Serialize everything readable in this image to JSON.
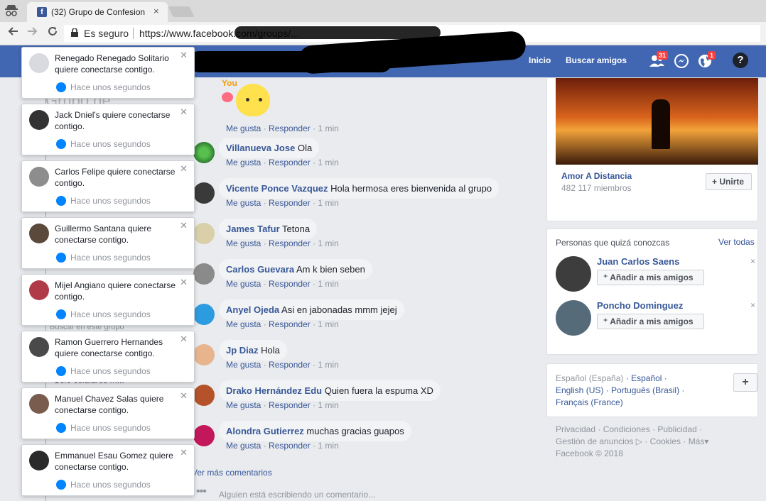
{
  "browser": {
    "tab_title": "(32) Grupo de Confesion",
    "tab_close": "×",
    "secure_label": "Es seguro",
    "url": "https://www.facebook.com/groups/..."
  },
  "fb_nav": {
    "home": "Inicio",
    "find_friends": "Buscar amigos",
    "friend_requests_badge": "31",
    "notifications_badge": "1",
    "help": "?"
  },
  "left_column": {
    "group_title_fragment": "Grupo de",
    "search_fragment": "Buscar en este grupo",
    "item_fragment": "Solo celulares m..."
  },
  "comments": [
    {
      "name": "",
      "text": "",
      "like": "Me gusta",
      "reply": "Responder",
      "time": "1 min",
      "sticker_text": "You"
    },
    {
      "name": "Villanueva Jose",
      "text": "Ola",
      "like": "Me gusta",
      "reply": "Responder",
      "time": "1 min"
    },
    {
      "name": "Vicente Ponce Vazquez",
      "text": "Hola hermosa eres bienvenida al grupo",
      "like": "Me gusta",
      "reply": "Responder",
      "time": "1 min"
    },
    {
      "name": "James Tafur",
      "text": "Tetona",
      "like": "Me gusta",
      "reply": "Responder",
      "time": "1 min"
    },
    {
      "name": "Carlos Guevara",
      "text": "Am k bien seben",
      "like": "Me gusta",
      "reply": "Responder",
      "time": "1 min"
    },
    {
      "name": "Anyel Ojeda",
      "text": "Asi en jabonadas mmm jejej",
      "like": "Me gusta",
      "reply": "Responder",
      "time": "1 min"
    },
    {
      "name": "Jp Diaz",
      "text": "Hola",
      "like": "Me gusta",
      "reply": "Responder",
      "time": "1 min"
    },
    {
      "name": "Drako Hernández Edu",
      "text": "Quien fuera la espuma XD",
      "like": "Me gusta",
      "reply": "Responder",
      "time": "1 min"
    },
    {
      "name": "Alondra Gutierrez",
      "text": "muchas gracias guapos",
      "like": "Me gusta",
      "reply": "Responder",
      "time": "1 min"
    }
  ],
  "more_comments": "Ver más comentarios",
  "typing": "Alguien está escribiendo un comentario...",
  "notifications": [
    {
      "text": "Renegado Renegado Solitario quiere conectarse contigo.",
      "time": "Hace unos segundos"
    },
    {
      "text": "Jack Dniel's quiere conectarse contigo.",
      "time": "Hace unos segundos"
    },
    {
      "text": "Carlos Felipe quiere conectarse contigo.",
      "time": "Hace unos segundos"
    },
    {
      "text": "Guillermo Santana quiere conectarse contigo.",
      "time": "Hace unos segundos"
    },
    {
      "text": "Mijel Angiano quiere conectarse contigo.",
      "time": "Hace unos segundos"
    },
    {
      "text": "Ramon Guerrero Hernandes quiere conectarse contigo.",
      "time": "Hace unos segundos"
    },
    {
      "text": "Manuel Chavez Salas quiere conectarse contigo.",
      "time": "Hace unos segundos"
    },
    {
      "text": "Emmanuel Esau Gomez quiere conectarse contigo.",
      "time": "Hace unos segundos"
    }
  ],
  "group_suggestion": {
    "name": "Amor A Distancia",
    "members": "482 117 miembros",
    "join": "Unirte"
  },
  "people": {
    "title": "Personas que quizá conozcas",
    "see_all": "Ver todas",
    "list": [
      {
        "name": "Juan Carlos Saens",
        "add": "Añadir a mis amigos"
      },
      {
        "name": "Poncho Dominguez",
        "add": "Añadir a mis amigos"
      }
    ]
  },
  "languages": {
    "line1_a": "Español (España)",
    "line1_b": "Español",
    "line2_a": "English (US)",
    "line2_b": "Português (Brasil)",
    "line3": "Français (France)"
  },
  "footer": {
    "privacidad": "Privacidad",
    "condiciones": "Condiciones",
    "publicidad": "Publicidad",
    "anuncios": "Gestión de anuncios",
    "cookies": "Cookies",
    "mas": "Más",
    "copyright": "Facebook © 2018"
  },
  "colors": {
    "fb_blue": "#4267b2",
    "link": "#385898",
    "badge_red": "#fa3e3e",
    "messenger": "#0084ff"
  }
}
